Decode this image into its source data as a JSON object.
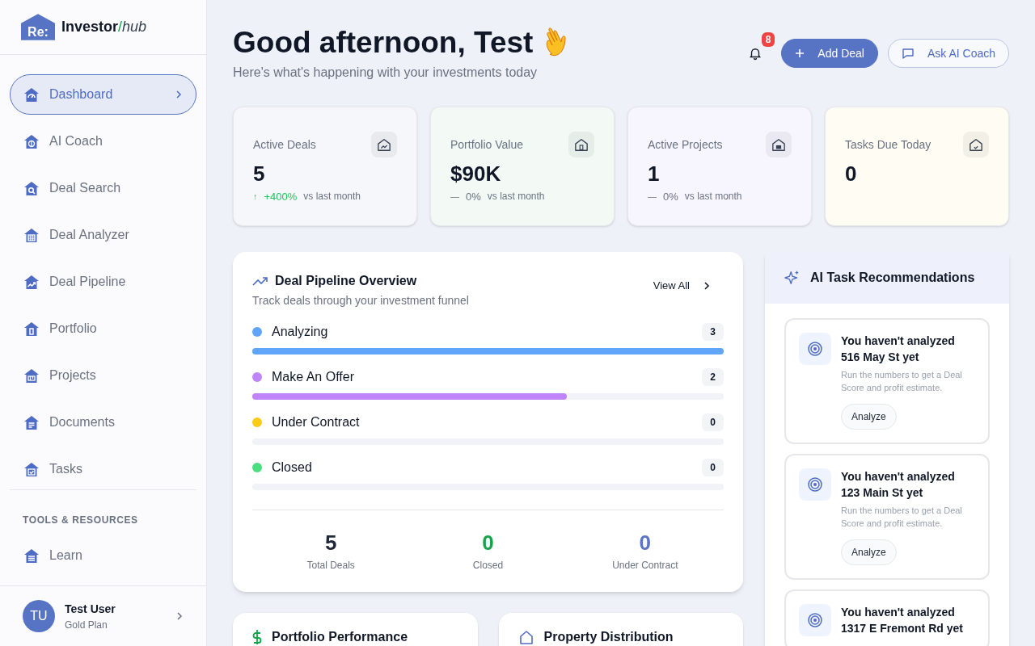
{
  "logo": {
    "badge": "Re:",
    "name": "Investor",
    "slash": "/",
    "suffix": "hub"
  },
  "sidebar": {
    "items": [
      {
        "label": "Dashboard",
        "selected": true
      },
      {
        "label": "AI Coach",
        "selected": false
      },
      {
        "label": "Deal Search",
        "selected": false
      },
      {
        "label": "Deal Analyzer",
        "selected": false
      },
      {
        "label": "Deal Pipeline",
        "selected": false
      },
      {
        "label": "Portfolio",
        "selected": false
      },
      {
        "label": "Projects",
        "selected": false
      },
      {
        "label": "Documents",
        "selected": false
      },
      {
        "label": "Tasks",
        "selected": false
      }
    ],
    "section_title": "TOOLS & RESOURCES",
    "tools": [
      {
        "label": "Learn",
        "selected": false
      }
    ],
    "user": {
      "initials": "TU",
      "name": "Test User",
      "plan": "Gold Plan"
    }
  },
  "header": {
    "title": "Good afternoon, Test",
    "subtitle": "Here's what's happening with your investments today",
    "notifications": "8",
    "buttons": [
      {
        "label": "Add Deal",
        "kind": "primary"
      },
      {
        "label": "Ask AI Coach",
        "kind": "outline"
      }
    ]
  },
  "stats": [
    {
      "label": "Active Deals",
      "value": "5",
      "trend_icon": "↑",
      "positive": true,
      "change": "+400%",
      "note": "vs last month",
      "color": "#f5f7fb"
    },
    {
      "label": "Portfolio Value",
      "value": "$90K",
      "trend_icon": "—",
      "positive": false,
      "change": "0%",
      "note": "vs last month",
      "color": "#f3faf5"
    },
    {
      "label": "Active Projects",
      "value": "1",
      "trend_icon": "—",
      "positive": false,
      "change": "0%",
      "note": "vs last month",
      "color": "#f7f6fe"
    },
    {
      "label": "Tasks Due Today",
      "value": "0",
      "color": "#fffdf3"
    }
  ],
  "pipeline": {
    "title": "Deal Pipeline Overview",
    "subtitle": "Track deals through your investment funnel",
    "view_all": "View All",
    "stages": [
      {
        "label": "Analyzing",
        "color": "#60a5fa",
        "count": "3",
        "level": 1
      },
      {
        "label": "Make An Offer",
        "color": "#c084fc",
        "count": "2",
        "level": 0.667
      },
      {
        "label": "Under Contract",
        "color": "#facc15",
        "count": "0",
        "level": 0
      },
      {
        "label": "Closed",
        "color": "#4ade80",
        "count": "0",
        "level": 0
      }
    ],
    "summary": [
      {
        "value": "5",
        "label": "Total Deals",
        "color": "#1f2937"
      },
      {
        "value": "0",
        "label": "Closed",
        "color": "#16a34a"
      },
      {
        "value": "0",
        "label": "Under Contract",
        "color": "#5b74c4"
      }
    ]
  },
  "recommendations": {
    "title": "AI Task Recommendations",
    "tasks": [
      {
        "title": "You haven't analyzed 516 May St yet",
        "description": "Run the numbers to get a Deal Score and profit estimate.",
        "action": "Analyze"
      },
      {
        "title": "You haven't analyzed 123 Main St yet",
        "description": "Run the numbers to get a Deal Score and profit estimate.",
        "action": "Analyze"
      },
      {
        "title": "You haven't analyzed 1317 E Fremont Rd yet"
      }
    ]
  },
  "bottom_cards": [
    {
      "title": "Portfolio Performance"
    },
    {
      "title": "Property Distribution"
    }
  ]
}
